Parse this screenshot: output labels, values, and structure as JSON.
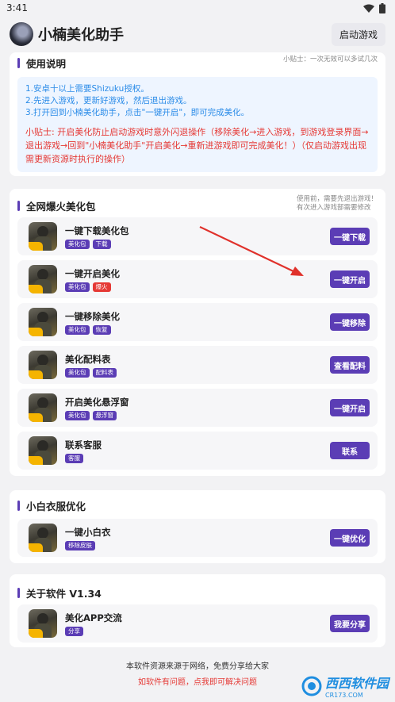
{
  "status": {
    "time": "3:41"
  },
  "app": {
    "title": "小楠美化助手",
    "launch_label": "启动游戏"
  },
  "usage": {
    "title": "使用说明",
    "tip": "小贴士：一次无效可以多试几次",
    "lines": [
      "1.安卓十以上需要Shizuku授权。",
      "2.先进入游戏，更新好游戏，然后退出游戏。",
      "3.打开回到小楠美化助手，点击\"一键开启\"，即可完成美化。"
    ],
    "warning": "小贴士: 开启美化防止启动游戏时意外闪退操作（移除美化→进入游戏，到游戏登录界面→退出游戏→回到\"小楠美化助手\"开启美化→重新进游戏即可完成美化！）（仅启动游戏出现需更新资源时执行的操作）"
  },
  "pack": {
    "title": "全网爆火美化包",
    "tip_line1": "使用前，需要先退出游戏！",
    "tip_line2": "有次进入游戏部需要修改",
    "items": [
      {
        "title": "一键下载美化包",
        "tags": [
          "美化包",
          "下载"
        ],
        "button": "一键下载"
      },
      {
        "title": "一键开启美化",
        "tags": [
          "美化包",
          "爆火"
        ],
        "button": "一键开启"
      },
      {
        "title": "一键移除美化",
        "tags": [
          "美化包",
          "恢复"
        ],
        "button": "一键移除"
      },
      {
        "title": "美化配料表",
        "tags": [
          "美化包",
          "配料表"
        ],
        "button": "查看配料"
      },
      {
        "title": "开启美化悬浮窗",
        "tags": [
          "美化包",
          "悬浮窗"
        ],
        "button": "一键开启"
      },
      {
        "title": "联系客服",
        "tags": [
          "客服"
        ],
        "button": "联系"
      }
    ]
  },
  "clothes": {
    "title": "小白衣服优化",
    "items": [
      {
        "title": "一键小白衣",
        "tags": [
          "移除皮肤"
        ],
        "button": "一键优化"
      }
    ]
  },
  "about": {
    "title": "关于软件 V1.34",
    "items": [
      {
        "title": "美化APP交流",
        "tags": [
          "分享"
        ],
        "button": "我要分享"
      }
    ]
  },
  "footer": {
    "line1": "本软件资源来源于网络，免费分享给大家",
    "line2": "如软件有问题，点我即可解决问题"
  },
  "watermark": {
    "text": "西西软件园",
    "url": "CR173.COM"
  },
  "colors": {
    "accent": "#5b3db5",
    "info": "#2b8ce8",
    "warning": "#e53935"
  }
}
